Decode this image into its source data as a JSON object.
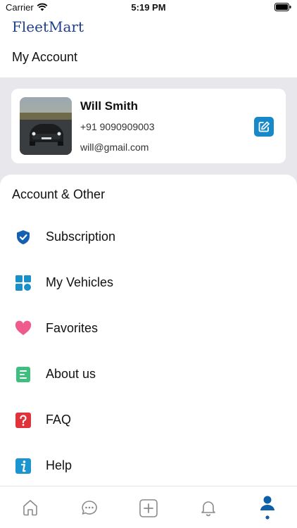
{
  "status_bar": {
    "carrier": "Carrier",
    "time": "5:19 PM"
  },
  "header": {
    "logo": "FleetMart",
    "title": "My Account"
  },
  "profile": {
    "name": "Will Smith",
    "phone": "+91 9090909003",
    "email": "will@gmail.com"
  },
  "menu": {
    "section_title": "Account & Other",
    "items": [
      {
        "label": "Subscription",
        "icon": "shield-check-icon",
        "color": "#1660b4"
      },
      {
        "label": "My Vehicles",
        "icon": "grid-icon",
        "color": "#1b8fc9"
      },
      {
        "label": "Favorites",
        "icon": "heart-icon",
        "color": "#ef5b8c"
      },
      {
        "label": "About us",
        "icon": "document-icon",
        "color": "#3fbf7f"
      },
      {
        "label": "FAQ",
        "icon": "question-icon",
        "color": "#e0323a"
      },
      {
        "label": "Help",
        "icon": "info-icon",
        "color": "#1b95cf"
      }
    ]
  },
  "tab_bar": {
    "tabs": [
      "home-icon",
      "chat-icon",
      "add-icon",
      "bell-icon",
      "profile-icon"
    ],
    "active": "profile-icon",
    "active_color": "#0d5fa8",
    "inactive_color": "#8a8a8a"
  },
  "colors": {
    "brand": "#1e3f8e",
    "accent": "#1789c8",
    "band_background": "#e8e8ec"
  }
}
